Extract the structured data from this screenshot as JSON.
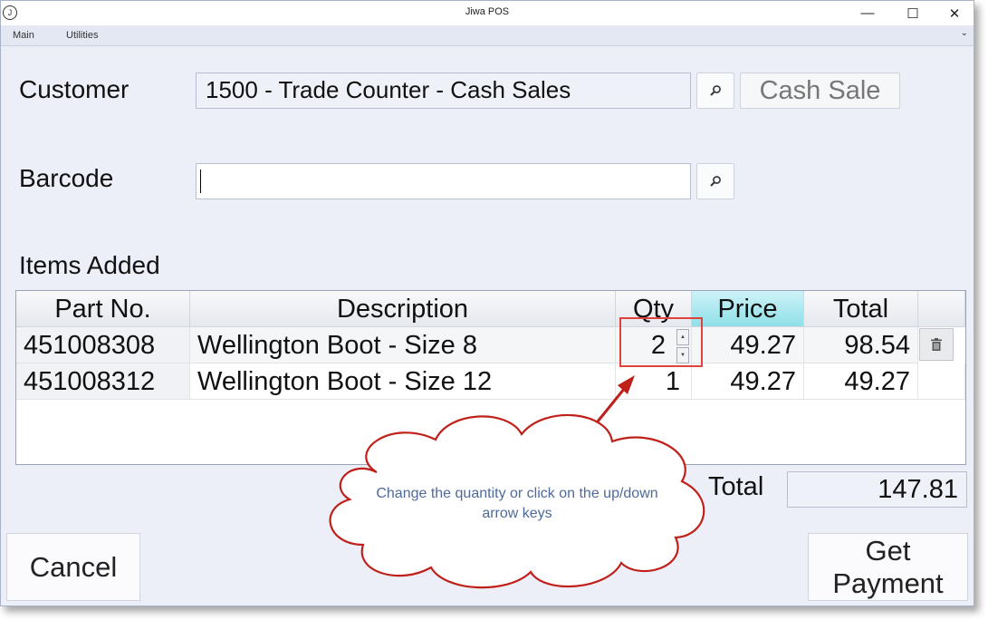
{
  "window": {
    "title": "Jiwa POS",
    "app_icon_glyph": "J",
    "controls": {
      "minimize": "—",
      "maximize": "☐",
      "close": "✕"
    }
  },
  "menu": {
    "items": [
      "Main",
      "Utilities"
    ],
    "chevron": "⌄"
  },
  "customer": {
    "label": "Customer",
    "value": "1500 - Trade Counter - Cash Sales",
    "search_icon": "magnifier-icon",
    "cash_sale_label": "Cash Sale"
  },
  "barcode": {
    "label": "Barcode",
    "value": "",
    "search_icon": "magnifier-icon"
  },
  "items_added": {
    "label": "Items Added",
    "columns": [
      "Part No.",
      "Description",
      "Qty",
      "Price",
      "Total"
    ],
    "rows": [
      {
        "part_no": "451008308",
        "description": "Wellington Boot - Size 8",
        "qty": "2",
        "price": "49.27",
        "total": "98.54"
      },
      {
        "part_no": "451008312",
        "description": "Wellington Boot - Size 12",
        "qty": "1",
        "price": "49.27",
        "total": "49.27"
      }
    ],
    "spin_up": "▲",
    "spin_down": "▼"
  },
  "total": {
    "label": "Total",
    "value": "147.81"
  },
  "buttons": {
    "cancel": "Cancel",
    "get_payment": "Get Payment"
  },
  "callout": {
    "text": "Change the quantity or click on the up/down arrow keys"
  },
  "colors": {
    "window_bg": "#eceff8",
    "header_accent": "#8fdfe8",
    "callout_outline": "#c0201a",
    "callout_text": "#4e6a9a"
  }
}
